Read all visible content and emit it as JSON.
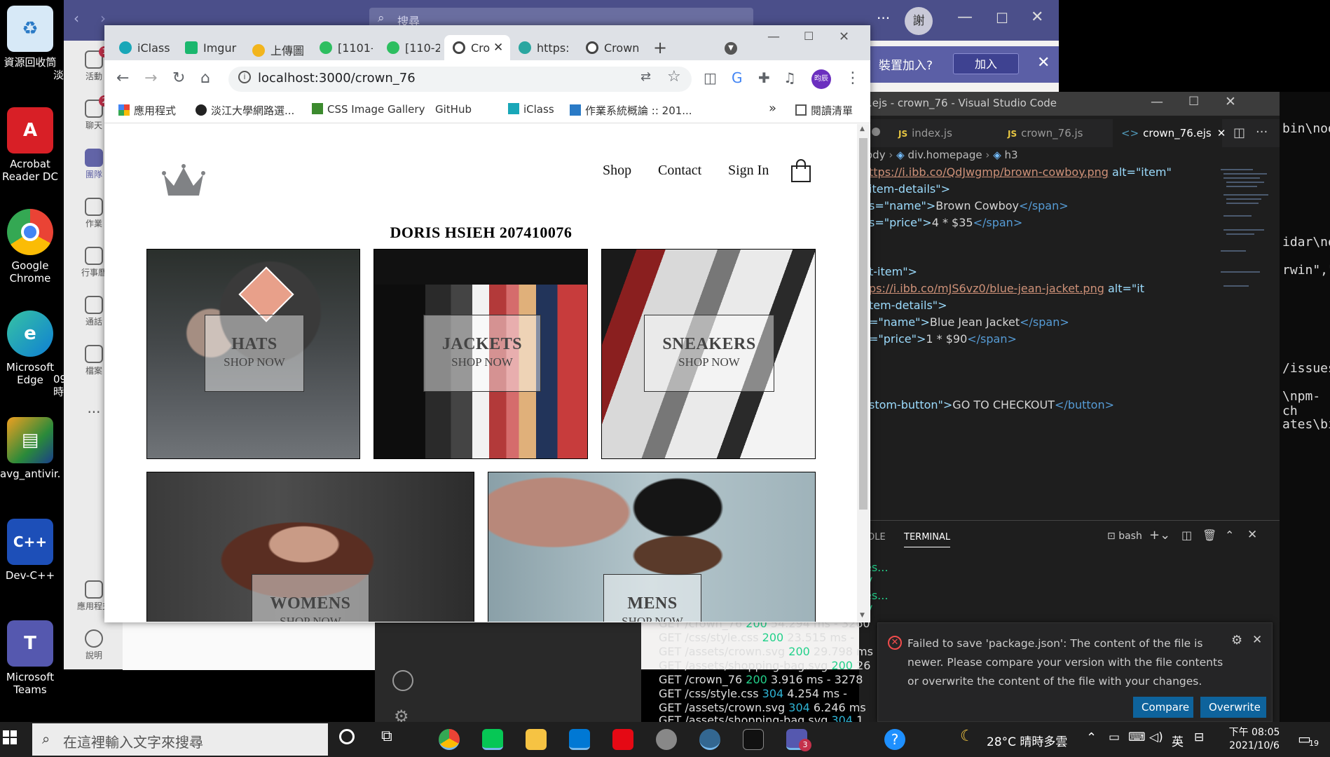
{
  "desktop": {
    "icons": [
      {
        "label": "資源回收筒",
        "color": "#7fb6e8",
        "glyph": "♻"
      },
      {
        "label": "Acrobat Reader DC",
        "color": "#d81f26",
        "glyph": "A"
      },
      {
        "label": "Google Chrome",
        "color": "#4285f4",
        "glyph": "◉"
      },
      {
        "label": "Microsoft Edge",
        "color": "#0f7fd4",
        "glyph": "e"
      },
      {
        "label": "avg_antivir...",
        "color": "#2a2a2a",
        "glyph": "▤"
      },
      {
        "label": "Dev-C++",
        "color": "#1d4fb8",
        "glyph": "C++"
      },
      {
        "label": "Microsoft Teams",
        "color": "#5558af",
        "glyph": "T"
      }
    ],
    "partial_labels": [
      "淡",
      "09 時"
    ]
  },
  "teams": {
    "search_placeholder": "搜尋",
    "avatar_text": "謝",
    "rail": [
      {
        "label": "活動",
        "badge": "1"
      },
      {
        "label": "聊天",
        "badge": "2"
      },
      {
        "label": "團隊",
        "badge": ""
      },
      {
        "label": "作業",
        "badge": ""
      },
      {
        "label": "行事曆",
        "badge": ""
      },
      {
        "label": "通話",
        "badge": ""
      },
      {
        "label": "檔案",
        "badge": ""
      },
      {
        "label": "...",
        "badge": ""
      },
      {
        "label": "應用程式",
        "badge": ""
      },
      {
        "label": "說明",
        "badge": ""
      }
    ],
    "banner_text": "裝置加入?",
    "join_label": "加入"
  },
  "chrome": {
    "tabs": [
      {
        "title": "iClass",
        "color": "#19a7b8"
      },
      {
        "title": "Imgur",
        "color": "#1bb76e"
      },
      {
        "title": "上傳圖",
        "color": "#f2b51d"
      },
      {
        "title": "[1101-",
        "color": "#2dbe60"
      },
      {
        "title": "[110-2",
        "color": "#2dbe60"
      },
      {
        "title": "Cro",
        "color": "#444444",
        "active": true
      },
      {
        "title": "https:",
        "color": "#2aa6a0"
      },
      {
        "title": "Crown",
        "color": "#444444"
      }
    ],
    "url": "localhost:3000/crown_76",
    "profile_text": "昀辰",
    "bookmarks": [
      {
        "label": "應用程式"
      },
      {
        "label": "淡江大學網路選..."
      },
      {
        "label": "CSS Image Gallery"
      },
      {
        "label": "GitHub"
      },
      {
        "label": "iClass"
      },
      {
        "label": "作業系統概論 :: 201..."
      }
    ],
    "bookmarks_overflow": "»",
    "reading_list": "閱讀清單"
  },
  "page": {
    "nav": {
      "shop": "Shop",
      "contact": "Contact",
      "sign_in": "Sign In"
    },
    "heading": "DORIS HSIEH 207410076",
    "tiles": [
      {
        "title": "HATS",
        "subtitle": "SHOP NOW"
      },
      {
        "title": "JACKETS",
        "subtitle": "SHOP NOW"
      },
      {
        "title": "SNEAKERS",
        "subtitle": "SHOP NOW"
      },
      {
        "title": "WOMENS",
        "subtitle": "SHOP NOW"
      },
      {
        "title": "MENS",
        "subtitle": "SHOP NOW"
      }
    ]
  },
  "vscode": {
    "title": ".ejs - crown_76 - Visual Studio Code",
    "tabs": [
      {
        "kind": "JS",
        "name": "index.js"
      },
      {
        "kind": "JS",
        "name": "crown_76.js"
      },
      {
        "kind": "<>",
        "name": "crown_76.ejs",
        "active": true
      }
    ],
    "breadcrumb": {
      "a": "ody",
      "b": "div.homepage",
      "c": "h3"
    },
    "code": {
      "l1_str": "ttps://i.ibb.co/QdJwgmp/brown-cowboy.png",
      "l1_attr": "alt=\"item\"",
      "l2": "item-details\">",
      "l3_attr": "s=\"name\">",
      "l3_text": "Brown Cowboy",
      "l3_close": "</span>",
      "l4_attr": "s=\"price\">",
      "l4_text": "4 * $35",
      "l4_close": "</span>",
      "l5": "t-item\">",
      "l6_str": "ps://i.ibb.co/mJS6vz0/blue-jean-jacket.png",
      "l6_attr": "alt=\"it",
      "l7": "tem-details\">",
      "l8_attr": "=\"name\">",
      "l8_text": "Blue Jean Jacket",
      "l8_close": "</span>",
      "l9_attr": "=\"price\">",
      "l9_text": "1 * $90",
      "l9_close": "</span>",
      "l10_attr": "stom-button\">",
      "l10_text": "GO TO CHECKOUT",
      "l10_close": "</button>"
    },
    "panel": {
      "left_tab": "OLE",
      "terminal_tab": "TERMINAL",
      "shell": "bash"
    },
    "terminal_partial": [
      "es...",
      "V",
      "es...",
      "V"
    ],
    "terminal": [
      {
        "verb": "GET",
        "path": "/crown_76",
        "status": "200",
        "rest": "54.294 ms - 3260"
      },
      {
        "verb": "GET",
        "path": "/css/style.css",
        "status": "200",
        "rest": "23.515 ms -"
      },
      {
        "verb": "GET",
        "path": "/assets/crown.svg",
        "status": "200",
        "rest": "29.798 ms"
      },
      {
        "verb": "GET",
        "path": "/assets/shopping-bag.svg",
        "status": "200",
        "rest": "26"
      },
      {
        "verb": "GET",
        "path": "/crown_76",
        "status": "200",
        "rest": "3.916 ms - 3278"
      },
      {
        "verb": "GET",
        "path": "/css/style.css",
        "status": "304",
        "rest": "4.254 ms -"
      },
      {
        "verb": "GET",
        "path": "/assets/crown.svg",
        "status": "304",
        "rest": "6.246 ms"
      },
      {
        "verb": "GET",
        "path": "/assets/shopping-bag.svg",
        "status": "304",
        "rest": "1"
      }
    ]
  },
  "right_strip_lines": [
    "bin\\node",
    "idar\\no",
    "rwin\",\"",
    "/issues",
    "\\npm-ch",
    "ates\\bi"
  ],
  "notification": {
    "message": "Failed to save 'package.json': The content of the file is newer. Please compare your version with the file contents or overwrite the content of the file with your changes.",
    "compare_label": "Compare",
    "overwrite_label": "Overwrite"
  },
  "taskbar": {
    "search_placeholder": "在這裡輸入文字來搜尋",
    "weather": "28°C 晴時多雲",
    "ime": "英",
    "time": "下午 08:05",
    "date": "2021/10/6",
    "notif_count": "19",
    "teams_badge": "3"
  },
  "colors": {
    "teams_purple": "#4b4f8a",
    "vscode_bg": "#1e1e1e",
    "vscode_button": "#0e639c",
    "chrome_tabbar": "#dee1e6"
  }
}
